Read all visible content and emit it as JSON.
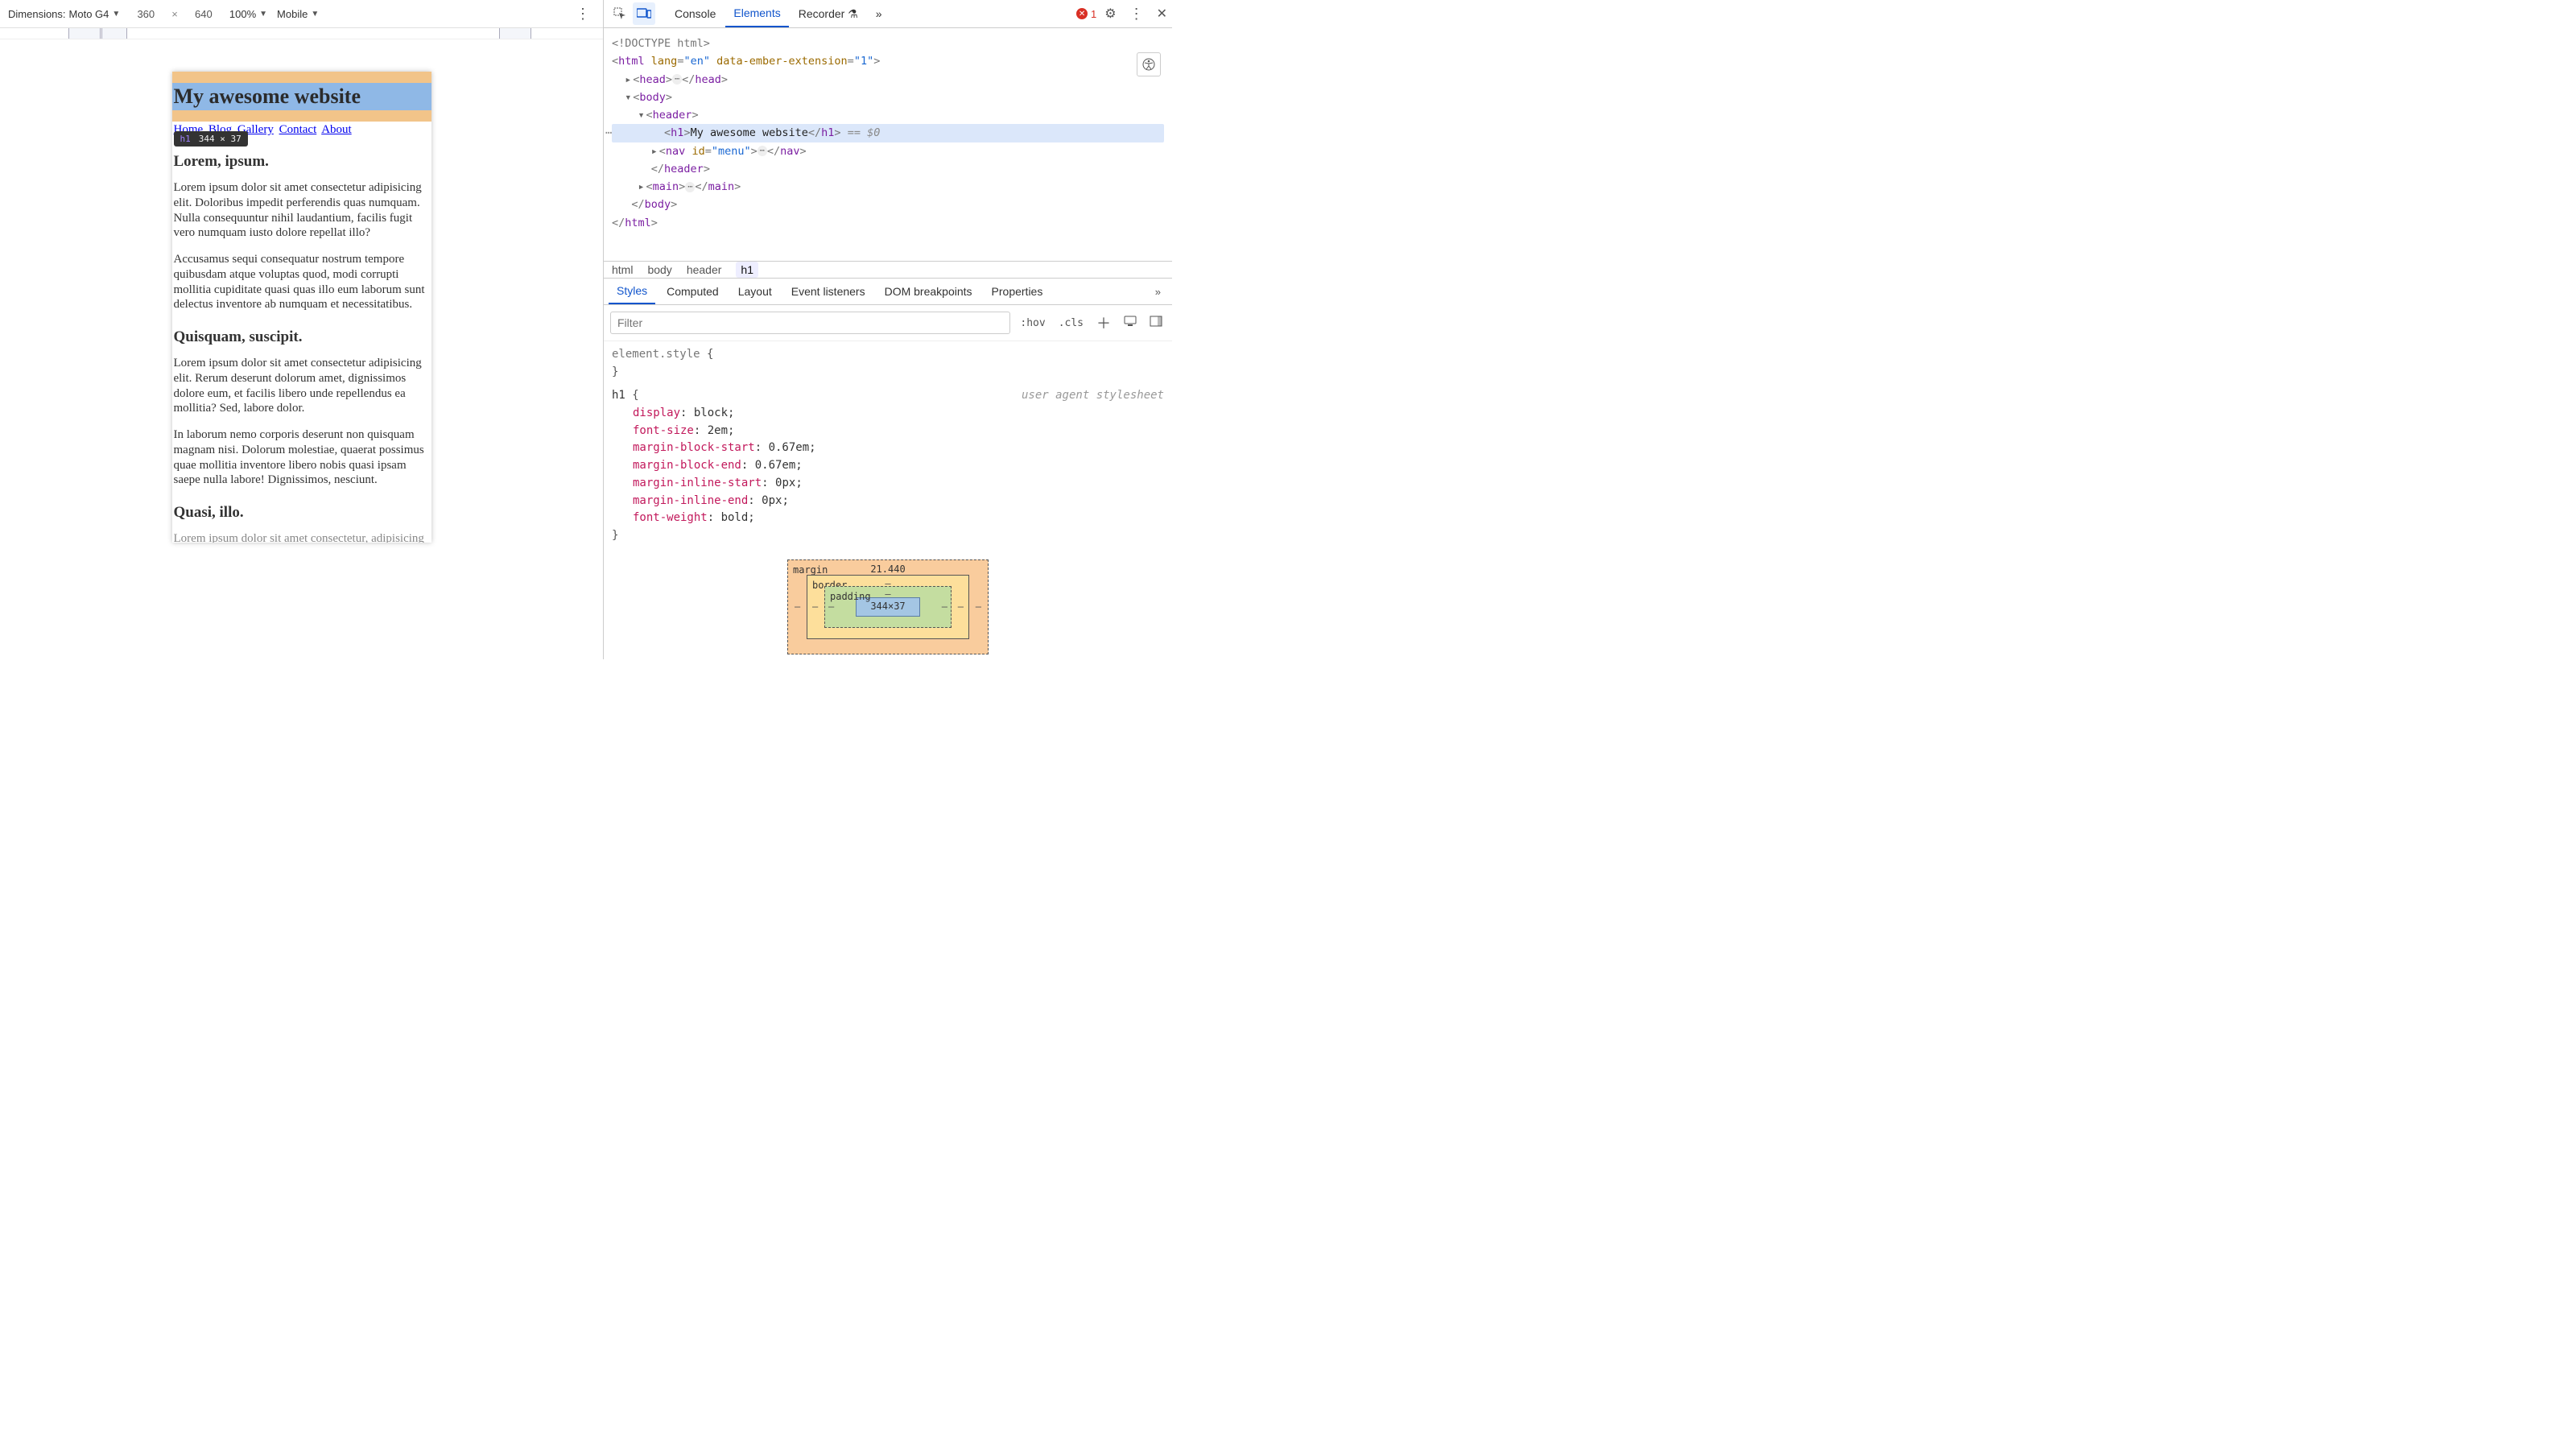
{
  "device_toolbar": {
    "dimensions_label": "Dimensions:",
    "device": "Moto G4",
    "width": "360",
    "times": "×",
    "height": "640",
    "zoom": "100%",
    "throttle": "Mobile"
  },
  "preview": {
    "title": "My awesome website",
    "nav": [
      "Home",
      "Blog",
      "Gallery",
      "Contact",
      "About"
    ],
    "tooltip_tag": "h1",
    "tooltip_size": "344 × 37",
    "sections": [
      {
        "heading": "Lorem, ipsum.",
        "paras": [
          "Lorem ipsum dolor sit amet consectetur adipisicing elit. Doloribus impedit perferendis quas numquam. Nulla consequuntur nihil laudantium, facilis fugit vero numquam iusto dolore repellat illo?",
          "Accusamus sequi consequatur nostrum tempore quibusdam atque voluptas quod, modi corrupti mollitia cupiditate quasi quas illo eum laborum sunt delectus inventore ab numquam et necessitatibus."
        ]
      },
      {
        "heading": "Quisquam, suscipit.",
        "paras": [
          "Lorem ipsum dolor sit amet consectetur adipisicing elit. Rerum deserunt dolorum amet, dignissimos dolore eum, et facilis libero unde repellendus ea mollitia? Sed, labore dolor.",
          "In laborum nemo corporis deserunt non quisquam magnam nisi. Dolorum molestiae, quaerat possimus quae mollitia inventore libero nobis quasi ipsam saepe nulla labore! Dignissimos, nesciunt."
        ]
      },
      {
        "heading": "Quasi, illo.",
        "paras": [
          "Lorem ipsum dolor sit amet consectetur, adipisicing"
        ]
      }
    ]
  },
  "devtools_tabs": {
    "console": "Console",
    "elements": "Elements",
    "recorder": "Recorder",
    "errors": "1"
  },
  "dom": {
    "doctype": "<!DOCTYPE html>",
    "html_open": {
      "tag": "html",
      "attrs": [
        [
          "lang",
          "en"
        ],
        [
          "data-ember-extension",
          "1"
        ]
      ]
    },
    "head": {
      "tag": "head"
    },
    "body": {
      "tag": "body"
    },
    "header": {
      "tag": "header"
    },
    "h1": {
      "tag": "h1",
      "text": "My awesome website",
      "refvar": "== $0"
    },
    "nav": {
      "tag": "nav",
      "attrs": [
        [
          "id",
          "menu"
        ]
      ]
    },
    "main": {
      "tag": "main"
    }
  },
  "breadcrumb": [
    "html",
    "body",
    "header",
    "h1"
  ],
  "styles_tabs": [
    "Styles",
    "Computed",
    "Layout",
    "Event listeners",
    "DOM breakpoints",
    "Properties"
  ],
  "filter": {
    "placeholder": "Filter",
    "hov": ":hov",
    "cls": ".cls"
  },
  "rules": {
    "element_style": "element.style",
    "ua_label": "user agent stylesheet",
    "h1_selector": "h1",
    "decls": [
      [
        "display",
        "block"
      ],
      [
        "font-size",
        "2em"
      ],
      [
        "margin-block-start",
        "0.67em"
      ],
      [
        "margin-block-end",
        "0.67em"
      ],
      [
        "margin-inline-start",
        "0px"
      ],
      [
        "margin-inline-end",
        "0px"
      ],
      [
        "font-weight",
        "bold"
      ]
    ]
  },
  "boxmodel": {
    "margin_label": "margin",
    "margin_top": "21.440",
    "border_label": "border",
    "padding_label": "padding",
    "content": "344×37",
    "dash": "–"
  }
}
